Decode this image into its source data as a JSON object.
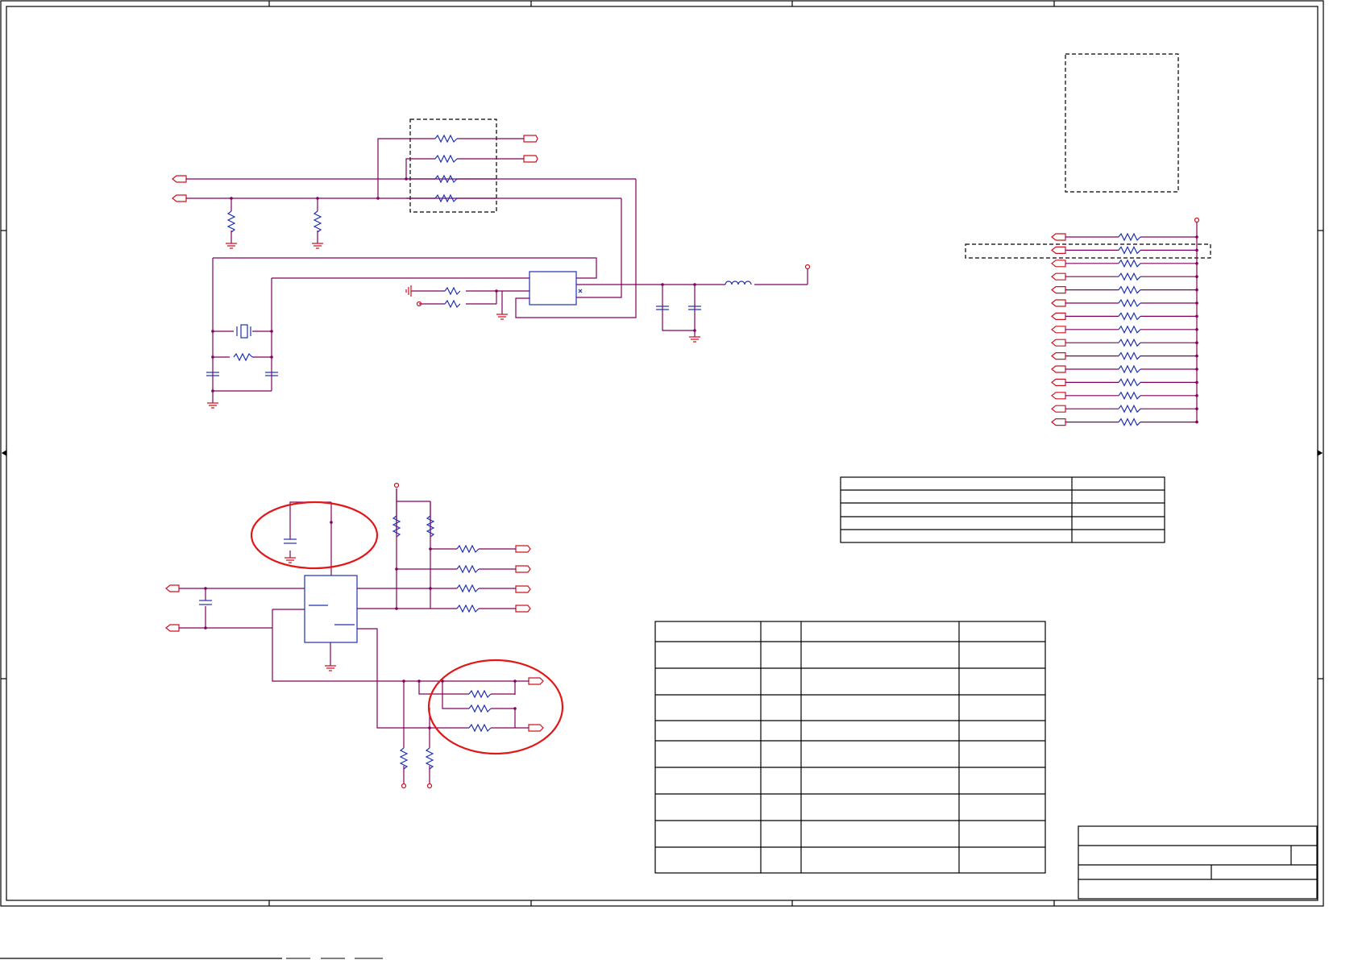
{
  "colors": {
    "wire_purple": "#800060",
    "wire_red": "#b0103a",
    "pin_red": "#d01020",
    "component_blue": "#2030b0",
    "frame": "#000000",
    "highlight_circle": "#e01818",
    "dashed_box": "#000000"
  },
  "sheet": {
    "frame": "drawing-frame",
    "zone_ticks": "border-zone-ticks"
  },
  "blocks": {
    "oscillator_section": {
      "name": "crystal-oscillator-section"
    },
    "resistor_ladder": {
      "name": "pull-up-resistor-ladder",
      "rows": 15
    },
    "regulator_section": {
      "name": "regulator-section"
    },
    "revision_table": {
      "rows": 5,
      "cols": 2
    },
    "bom_table": {
      "rows": 10,
      "cols": 4
    },
    "title_block": {
      "name": "title-block"
    }
  },
  "labels": {
    "page_legend": ""
  }
}
